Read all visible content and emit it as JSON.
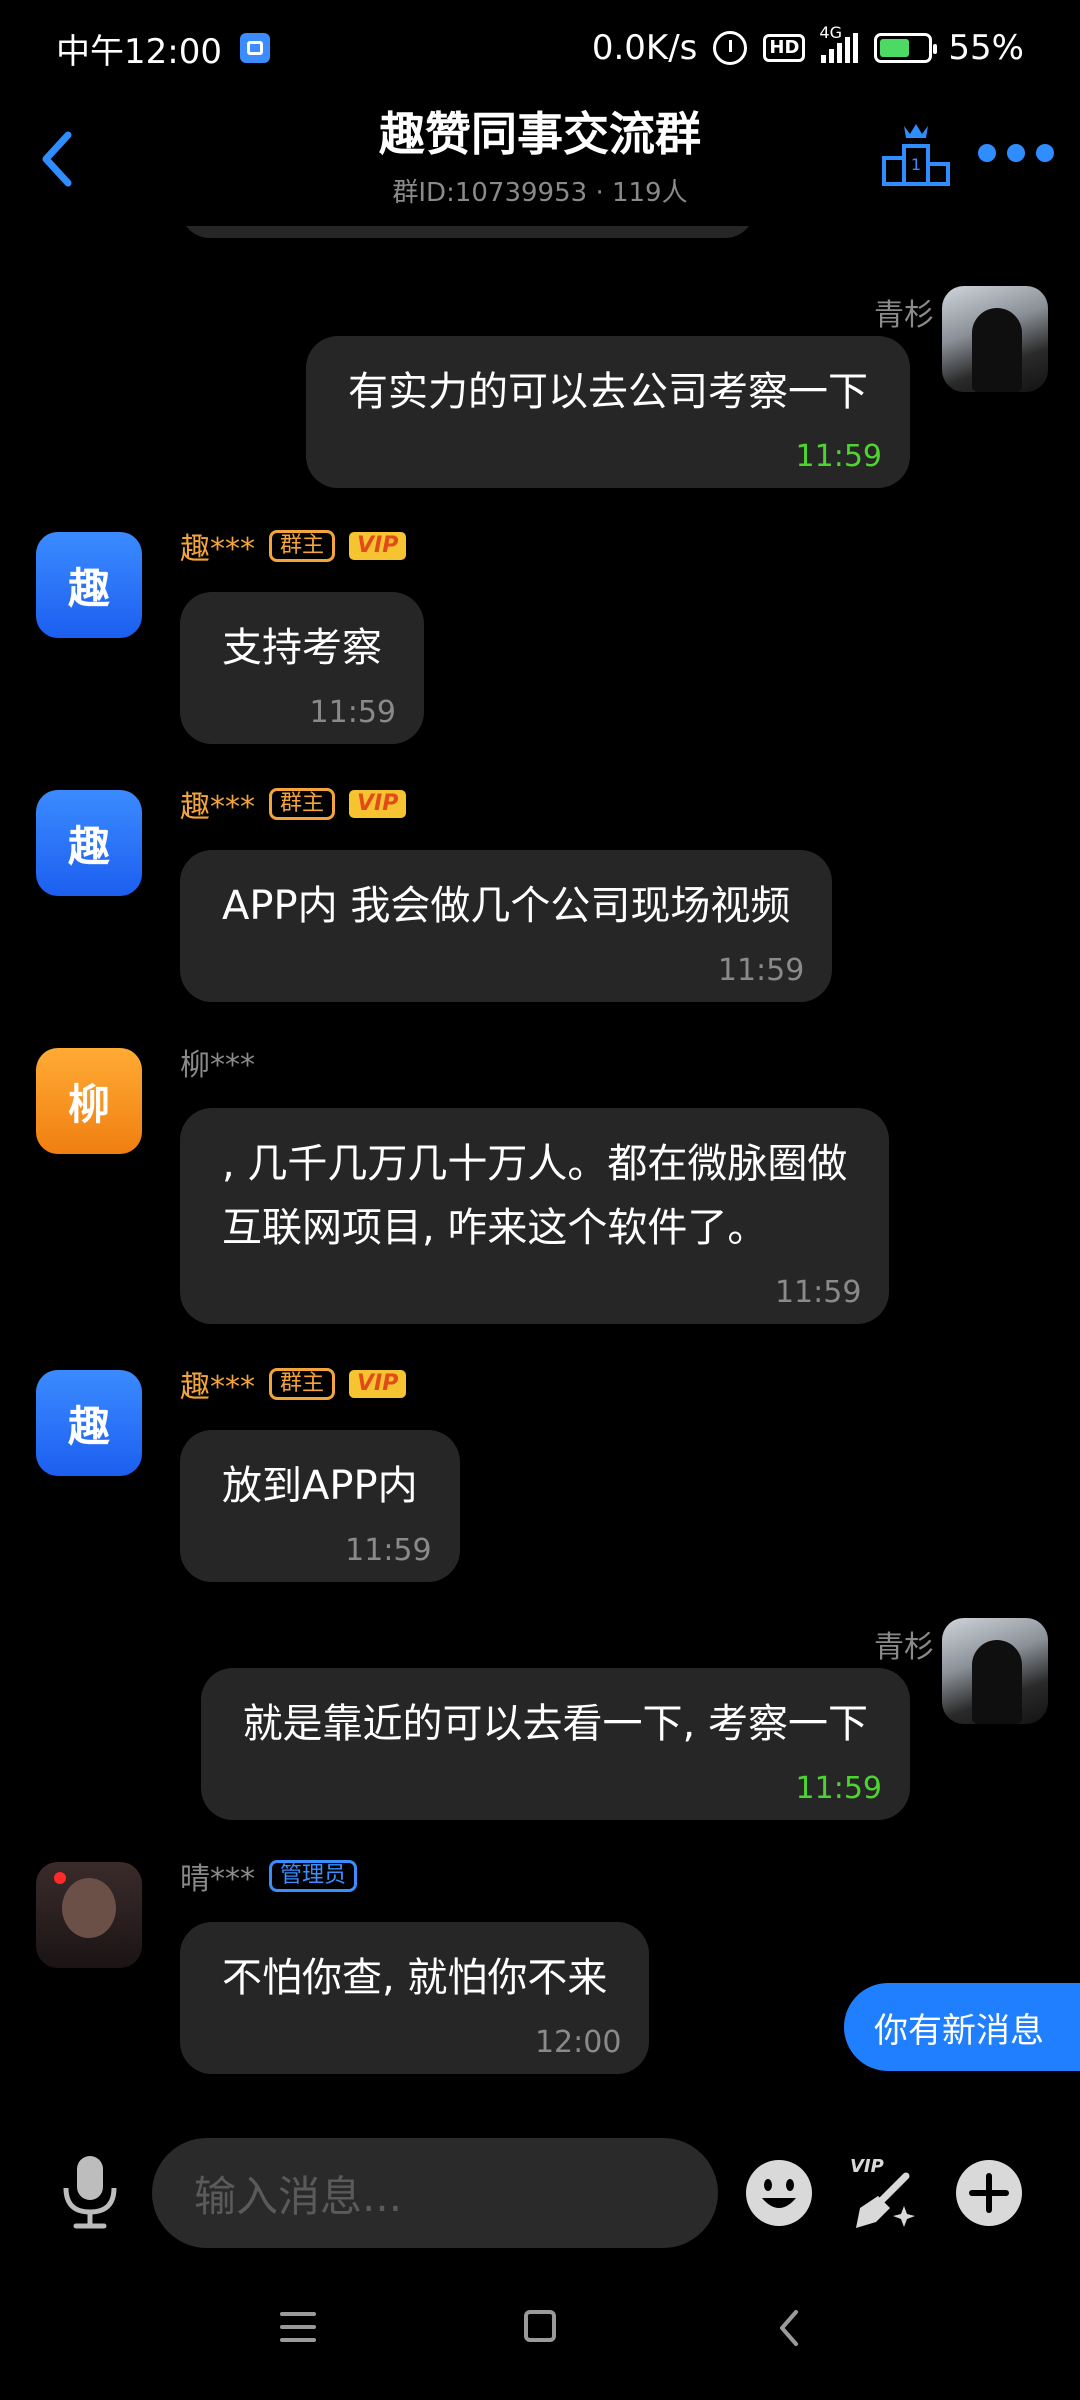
{
  "status_bar": {
    "time": "中午12:00",
    "speed": "0.0K/s",
    "hd": "HD",
    "network": "4G",
    "battery": "55%"
  },
  "header": {
    "title": "趣赞同事交流群",
    "subtitle": "群ID:10739953 · 119人",
    "icons": [
      "back-icon",
      "ranking-icon",
      "more-icon"
    ]
  },
  "badges": {
    "owner": "群主",
    "vip": "VIP",
    "admin": "管理员"
  },
  "messages": [
    {
      "side": "right",
      "sender": "青杉",
      "text": "有实力的可以去公司考察一下",
      "time": "11:59"
    },
    {
      "side": "left",
      "sender": "趣***",
      "avatar_char": "趣",
      "role": "owner",
      "text": "支持考察",
      "time": "11:59"
    },
    {
      "side": "left",
      "sender": "趣***",
      "avatar_char": "趣",
      "role": "owner",
      "text": "APP内 我会做几个公司现场视频",
      "time": "11:59"
    },
    {
      "side": "left",
      "sender": "柳***",
      "avatar_char": "柳",
      "lines": [
        ", 几千几万几十万人。都在微脉圈做",
        "互联网项目, 咋来这个软件了。"
      ],
      "time": "11:59"
    },
    {
      "side": "left",
      "sender": "趣***",
      "avatar_char": "趣",
      "role": "owner",
      "text": "放到APP内",
      "time": "11:59"
    },
    {
      "side": "right",
      "sender": "青杉",
      "text": "就是靠近的可以去看一下, 考察一下",
      "time": "11:59"
    },
    {
      "side": "left",
      "sender": "晴***",
      "role": "admin",
      "text": "不怕你查, 就怕你不来",
      "time": "12:00"
    }
  ],
  "new_message_tip": "你有新消息",
  "input": {
    "placeholder": "输入消息..."
  },
  "colors": {
    "accent": "#1f7fff",
    "owner": "#f3a43a",
    "my_time": "#4ed430",
    "bubble": "#262626"
  }
}
